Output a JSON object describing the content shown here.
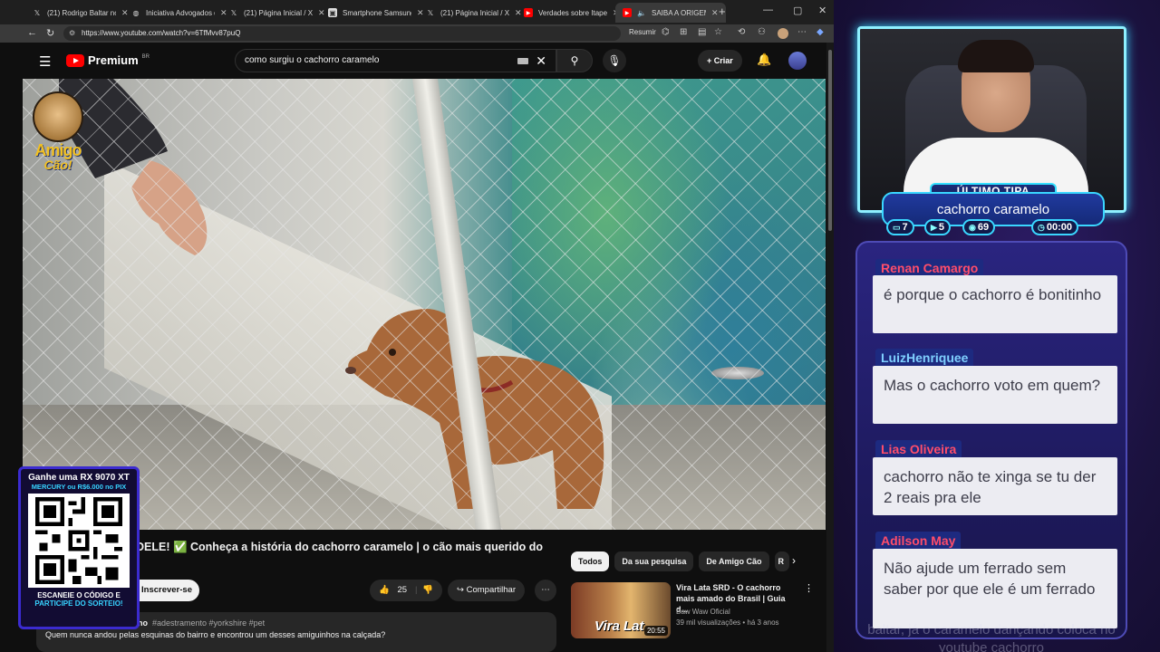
{
  "browser": {
    "tabs": [
      {
        "label": "(21) Rodrigo Baltar no",
        "fav": "x-logo"
      },
      {
        "label": "Iniciativa Advogados d",
        "fav": "globe-icon"
      },
      {
        "label": "(21) Página Inicial / X",
        "fav": "x-logo"
      },
      {
        "label": "Smartphone Samsung",
        "fav": "store-icon"
      },
      {
        "label": "(21) Página Inicial / X",
        "fav": "x-logo"
      },
      {
        "label": "Verdades sobre Itaper",
        "fav": "youtube-icon"
      },
      {
        "label": "SAIBA A ORIGEM",
        "fav": "youtube-icon"
      }
    ],
    "url": "https://www.youtube.com/watch?v=6TfMvv87puQ",
    "resumir": "Resumir"
  },
  "youtube": {
    "logo_text": "Premium",
    "region": "BR",
    "search_value": "como surgiu o cachorro caramelo",
    "create_label": "Criar",
    "video_logo_line1": "Amigo",
    "video_logo_line2": "Cão!",
    "video_title": "DELE! ✅ Conheça a história do cachorro caramelo | o cão mais querido do",
    "subscribe_label": "Inscrever-se",
    "likes": "25",
    "share_label": "Compartilhar",
    "desc_channel_tail": "no",
    "desc_tags": "#adestramento #yorkshire #pet",
    "desc_text": "Quem nunca andou pelas esquinas do bairro e encontrou um desses amiguinhos na calçada?",
    "chips": [
      "Todos",
      "Da sua pesquisa",
      "De Amigo Cão",
      "R"
    ],
    "rec": {
      "title": "Vira Lata SRD - O cachorro mais amado do Brasil | Guia d...",
      "channel": "Baw Waw Oficial",
      "meta": "39 mil visualizações  •  há 3 anos",
      "duration": "20:55",
      "thumb_label": "Vira Lat"
    }
  },
  "qr_promo": {
    "line1": "Ganhe uma RX 9070 XT",
    "line2": "MERCURY ou R$6.000 no PIX",
    "line3": "ESCANEIE O CÓDIGO E",
    "line4": "PARTICIPE DO SORTEIO!"
  },
  "stream": {
    "badge_title": "ÚLTIMO TIPA",
    "badge_main": "cachorro caramelo",
    "stats": [
      "7",
      "5",
      "69",
      "00:00"
    ],
    "chat": [
      {
        "name": "Renan Camargo",
        "text": "é porque o cachorro é bonitinho",
        "color": "#ff4d6a"
      },
      {
        "name": "LuizHenriquee",
        "text": "Mas o cachorro voto em quem?",
        "color": "#7fd0ff"
      },
      {
        "name": "Lias Oliveira",
        "text": "cachorro não te xinga se tu der 2 reais pra ele",
        "color": "#ff4d6a"
      },
      {
        "name": "Adilson May",
        "text": "Não ajude um ferrado sem saber por que ele é um ferrado",
        "color": "#ff4d6a"
      }
    ],
    "chat_footer": "baltar, já o caramelo dançando coloca no youtube cachorro"
  }
}
